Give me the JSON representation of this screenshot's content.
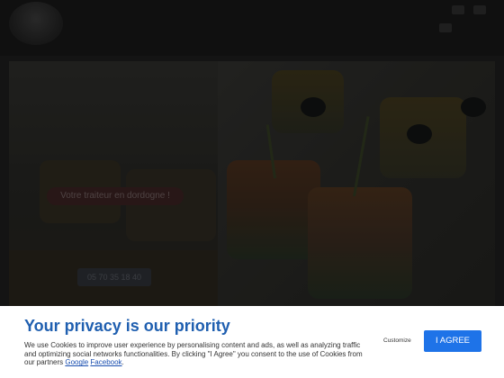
{
  "page": {
    "hero_title": "",
    "tagline": "Votre traiteur en dordogne !",
    "phone": "05 70 35 18 40"
  },
  "cookie_banner": {
    "title": "Your privacy is our priority",
    "body": "We use Cookies to improve user experience by personalising content and ads, as well as analyzing traffic and optimizing social networks functionalities. By clicking \"I Agree\" you consent to the use of Cookies from our partners",
    "partner_google": "Google",
    "partner_facebook": "Facebook",
    "end_punct": ".",
    "customize_label": "Customize",
    "agree_label": "I AGREE"
  },
  "colors": {
    "title_blue": "#1f5fb0",
    "agree_blue": "#1e73e8",
    "banner_bg": "#ffffff"
  }
}
